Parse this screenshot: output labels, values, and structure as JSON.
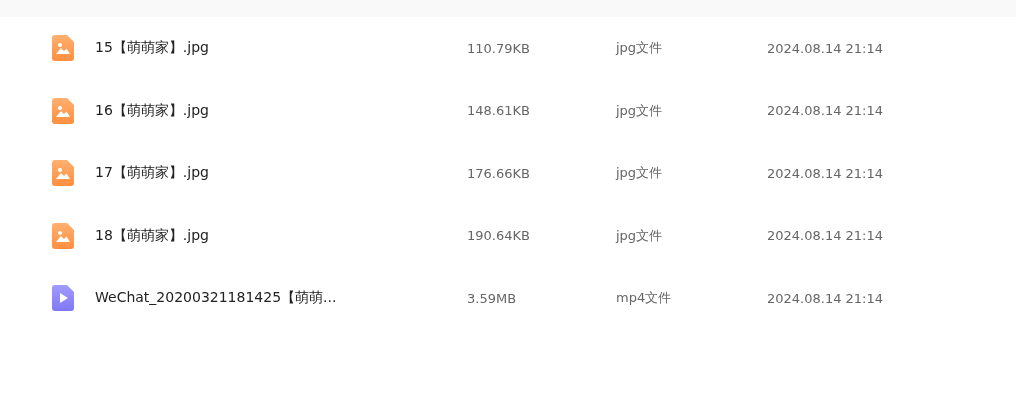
{
  "files": [
    {
      "kind": "image",
      "name": "15【萌萌家】.jpg",
      "size": "110.79KB",
      "type": "jpg文件",
      "modified": "2024.08.14 21:14"
    },
    {
      "kind": "image",
      "name": "16【萌萌家】.jpg",
      "size": "148.61KB",
      "type": "jpg文件",
      "modified": "2024.08.14 21:14"
    },
    {
      "kind": "image",
      "name": "17【萌萌家】.jpg",
      "size": "176.66KB",
      "type": "jpg文件",
      "modified": "2024.08.14 21:14"
    },
    {
      "kind": "image",
      "name": "18【萌萌家】.jpg",
      "size": "190.64KB",
      "type": "jpg文件",
      "modified": "2024.08.14 21:14"
    },
    {
      "kind": "video",
      "name": "WeChat_20200321181425【萌萌...",
      "size": "3.59MB",
      "type": "mp4文件",
      "modified": "2024.08.14 21:14"
    }
  ]
}
